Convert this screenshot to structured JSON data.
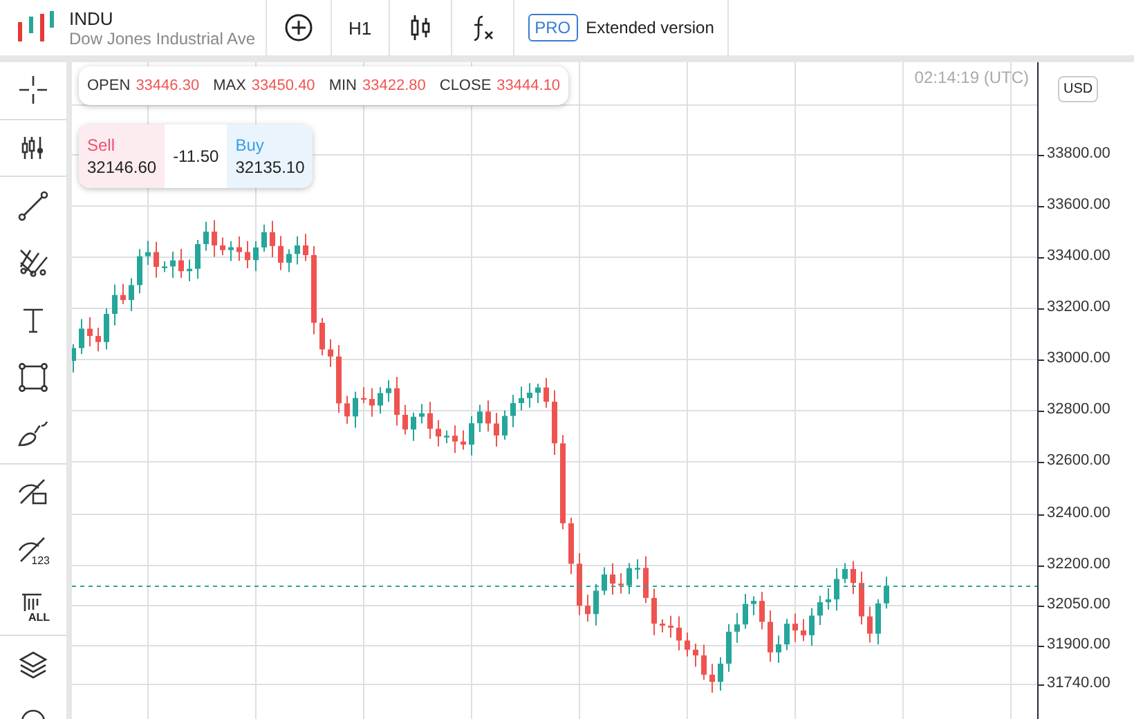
{
  "header": {
    "symbol": "INDU",
    "name": "Dow Jones Industrial Ave",
    "timeframe": "H1",
    "pro_badge": "PRO",
    "pro_label": "Extended version"
  },
  "tools": [
    {
      "kind": "crosshair",
      "divider_after": true
    },
    {
      "kind": "indicators",
      "divider_after": true
    },
    {
      "kind": "line",
      "divider_after": false
    },
    {
      "kind": "fork",
      "divider_after": false
    },
    {
      "kind": "text",
      "divider_after": false
    },
    {
      "kind": "rectangle",
      "divider_after": false
    },
    {
      "kind": "brush",
      "divider_after": true
    },
    {
      "kind": "hide-drawings",
      "divider_after": false
    },
    {
      "kind": "hide-labels",
      "caption": "123",
      "divider_after": false
    },
    {
      "kind": "delete-all",
      "caption": "ALL",
      "divider_after": true
    },
    {
      "kind": "layers",
      "divider_after": false
    },
    {
      "kind": "more",
      "divider_after": false
    }
  ],
  "ohlc": [
    {
      "label": "OPEN",
      "value": "33446.30"
    },
    {
      "label": "MAX",
      "value": "33450.40"
    },
    {
      "label": "MIN",
      "value": "33422.80"
    },
    {
      "label": "CLOSE",
      "value": "33444.10"
    }
  ],
  "quote": {
    "sell_label": "Sell",
    "sell": "32146.60",
    "spread": "-11.50",
    "buy_label": "Buy",
    "buy": "32135.10"
  },
  "clock": "02:14:19 (UTC)",
  "currency": "USD",
  "price_axis": [
    "33800.00",
    "33600.00",
    "33400.00",
    "33200.00",
    "33000.00",
    "32800.00",
    "32600.00",
    "32400.00",
    "32200.00",
    "32050.00",
    "31900.00",
    "31740.00"
  ]
}
